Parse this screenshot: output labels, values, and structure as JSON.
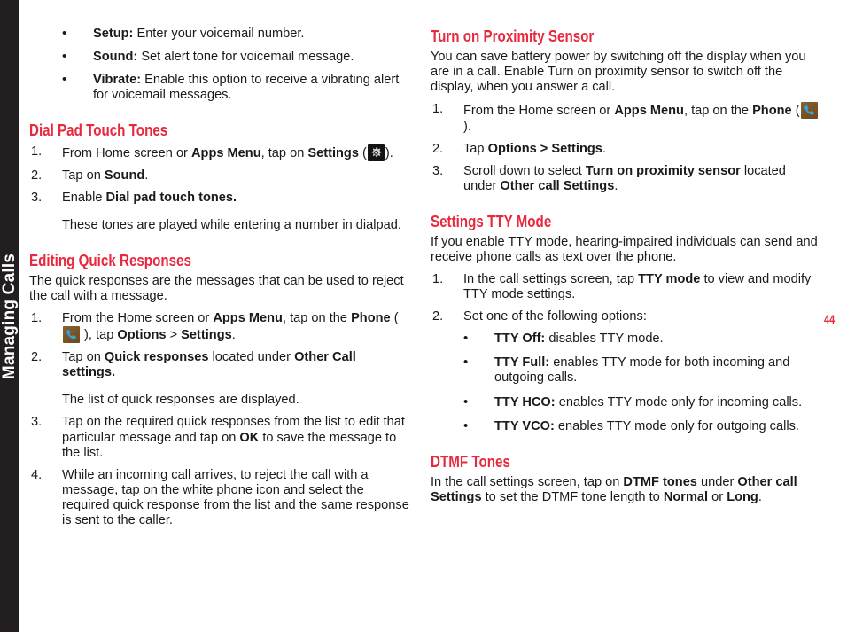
{
  "chapter_tab": {
    "label": "Managing Calls",
    "background_color": "#231f20",
    "text_color": "#ffffff"
  },
  "page_number": "44",
  "accent_color": "#e8283c",
  "icons": {
    "gear": "settings-gear-icon",
    "phone": "phone-handset-icon"
  },
  "left_column": {
    "voicemail_bullets": [
      {
        "term": "Setup:",
        "text": " Enter your voicemail number."
      },
      {
        "term": "Sound:",
        "text": " Set alert tone for voicemail message."
      },
      {
        "term": "Vibrate:",
        "text": " Enable this option to receive a vibrating alert for voicemail messages."
      }
    ],
    "dial_pad_section": {
      "heading": "Dial Pad Touch Tones",
      "steps": [
        {
          "number": "1.",
          "pre": "From Home screen or ",
          "bold1": "Apps Menu",
          "mid": ", tap on ",
          "bold2": "Settings",
          "post": " (",
          "icon": "gear",
          "tail": ")."
        },
        {
          "number": "2.",
          "pre": "Tap on ",
          "bold1": "Sound",
          "post": "."
        },
        {
          "number": "3.",
          "pre": "Enable ",
          "bold1": "Dial pad touch tones.",
          "post": ""
        }
      ],
      "note": "These tones are played while entering a number in dialpad."
    },
    "quick_responses_section": {
      "heading": "Editing Quick Responses",
      "intro": "The quick responses are the messages that can be used to reject the call with a message.",
      "step1": {
        "number": "1.",
        "pre": "From the Home screen or ",
        "bold1": "Apps Menu",
        "mid": ", tap on the ",
        "bold2": "Phone",
        "post": " (",
        "icon": "phone",
        "mid2": " ), tap ",
        "bold3": "Options",
        "mid3": " > ",
        "bold4": "Settings",
        "tail": "."
      },
      "step2": {
        "number": "2.",
        "pre": "Tap on ",
        "bold1": "Quick responses",
        "mid": " located under ",
        "bold2": "Other Call settings.",
        "post": ""
      },
      "step2_note": "The list of quick responses are displayed.",
      "step3": {
        "number": "3.",
        "pre": "Tap on the required quick responses from the list to edit that particular message and tap on ",
        "bold1": "OK",
        "post": " to save the message to the list."
      },
      "step4": {
        "number": "4.",
        "text": "While an incoming call arrives, to reject the call with a message, tap on the white phone icon and select the required quick response from the list and the same response is sent to the caller."
      }
    }
  },
  "right_column": {
    "proximity_section": {
      "heading": "Turn on Proximity Sensor",
      "intro": "You can save battery power by switching off the display when you are in a call. Enable Turn on proximity sensor to switch off the display, when you answer a call.",
      "step1": {
        "number": "1.",
        "pre": "From the Home screen or ",
        "bold1": "Apps Menu",
        "mid": ", tap on the ",
        "bold2": "Phone",
        "post": " (",
        "icon": "phone",
        "tail": " )."
      },
      "step2": {
        "number": "2.",
        "pre": "Tap ",
        "bold1": "Options > Settings",
        "post": "."
      },
      "step3": {
        "number": "3.",
        "pre": "Scroll down to select ",
        "bold1": "Turn on proximity sensor",
        "mid": " located under ",
        "bold2": "Other call Settings",
        "post": "."
      }
    },
    "tty_section": {
      "heading": "Settings TTY Mode",
      "intro": "If you enable TTY mode, hearing-impaired individuals can send and receive phone calls as text over the phone.",
      "step1": {
        "number": "1.",
        "pre": "In the call settings screen, tap ",
        "bold1": "TTY mode",
        "post": " to view and modify TTY mode settings."
      },
      "step2": {
        "number": "2.",
        "text": "Set one of the following options:"
      },
      "options": [
        {
          "term": "TTY Off:",
          "text": " disables TTY mode."
        },
        {
          "term": "TTY Full:",
          "text": " enables TTY mode for both incoming and outgoing calls."
        },
        {
          "term": "TTY HCO:",
          "text": " enables TTY mode only for incoming calls."
        },
        {
          "term": "TTY VCO:",
          "text": " enables TTY mode only for outgoing calls."
        }
      ]
    },
    "dtmf_section": {
      "heading": "DTMF Tones",
      "pre": "In the call settings screen, tap on ",
      "bold1": "DTMF tones",
      "mid": " under ",
      "bold2": "Other call Settings",
      "mid2": " to set the DTMF tone length to ",
      "bold3": "Normal",
      "mid3": " or ",
      "bold4": "Long",
      "post": "."
    }
  }
}
